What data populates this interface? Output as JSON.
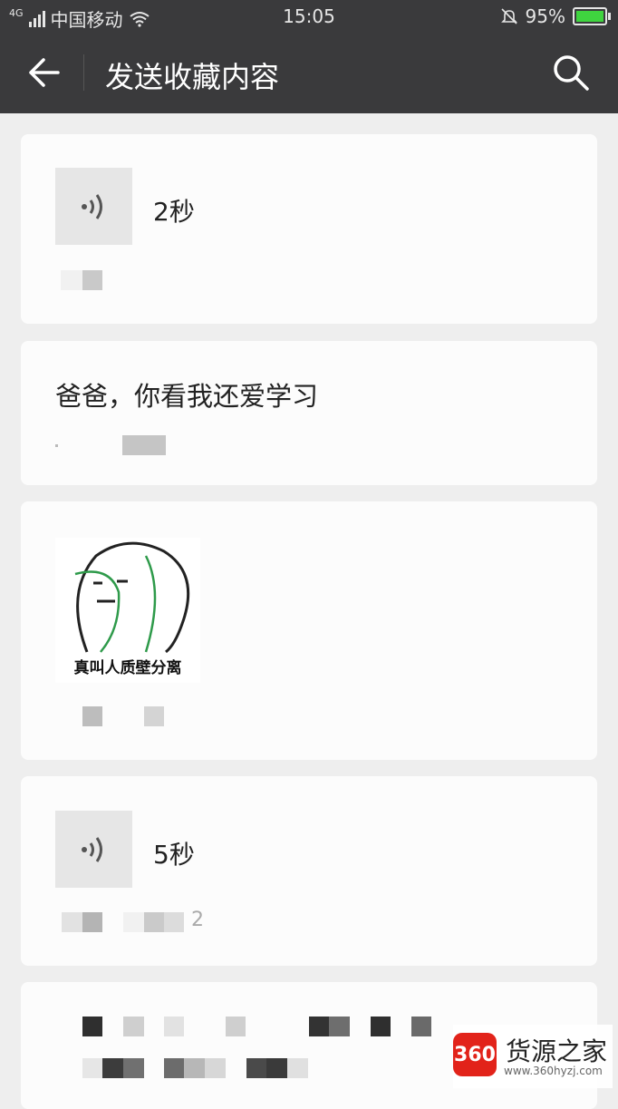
{
  "status": {
    "carrier": "中国移动",
    "network": "4G",
    "time": "15:05",
    "battery": "95%"
  },
  "header": {
    "title": "发送收藏内容"
  },
  "items": [
    {
      "type": "voice",
      "duration": "2秒"
    },
    {
      "type": "text",
      "text": "爸爸，你看我还爱学习"
    },
    {
      "type": "image",
      "caption": "真叫人质壁分离"
    },
    {
      "type": "voice",
      "duration": "5秒",
      "meta_suffix": "2"
    },
    {
      "type": "blurred"
    }
  ],
  "watermark": {
    "badge": "360",
    "name": "货源之家",
    "url": "www.360hyzj.com"
  }
}
